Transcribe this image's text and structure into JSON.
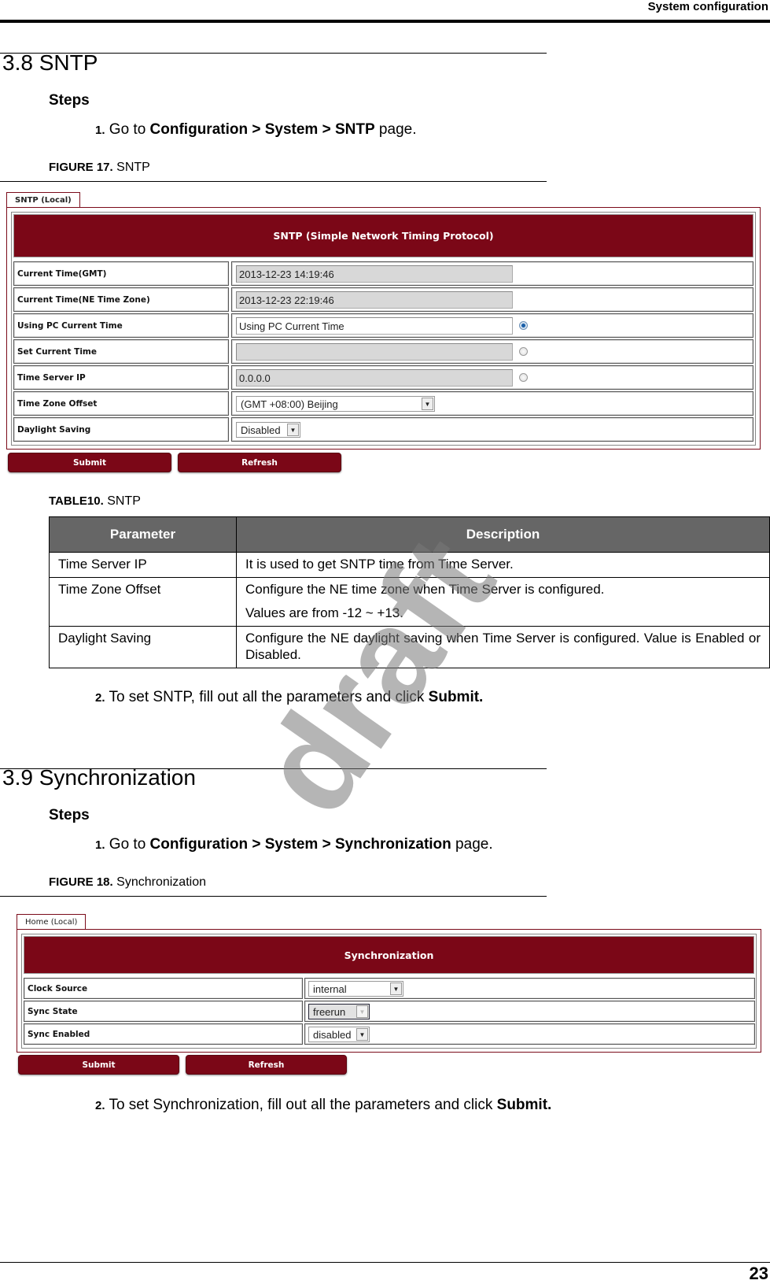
{
  "header": {
    "running_title": "System configuration"
  },
  "footer": {
    "page_number": "23"
  },
  "watermark": "draft",
  "sections": [
    {
      "title": "3.8 SNTP",
      "steps_label": "Steps",
      "step1": {
        "num": "1.",
        "prefix": "Go to ",
        "path": "Configuration > System > SNTP",
        "suffix": " page."
      },
      "figure": {
        "label": "FIGURE 17.",
        "title": "SNTP"
      },
      "step2": {
        "num": "2.",
        "prefix": "To set SNTP, fill out all the parameters and click ",
        "action": "Submit."
      }
    },
    {
      "title": "3.9 Synchronization",
      "steps_label": "Steps",
      "step1": {
        "num": "1.",
        "prefix": "Go to ",
        "path": "Configuration > System > Synchronization",
        "suffix": " page."
      },
      "figure": {
        "label": "FIGURE 18.",
        "title": "Synchronization"
      },
      "step2": {
        "num": "2.",
        "prefix": "To set Synchronization, fill out all the parameters and click ",
        "action": "Submit."
      }
    }
  ],
  "sntp_ui": {
    "tab": "SNTP (Local)",
    "banner": "SNTP (Simple Network Timing Protocol)",
    "rows": [
      {
        "label": "Current Time(GMT)",
        "value": "2013-12-23 14:19:46"
      },
      {
        "label": "Current Time(NE Time Zone)",
        "value": "2013-12-23 22:19:46"
      },
      {
        "label": "Using PC Current Time",
        "value": "Using PC Current Time",
        "radio": "selected"
      },
      {
        "label": "Set Current Time",
        "value": "",
        "radio": "unselected"
      },
      {
        "label": "Time Server IP",
        "value": "0.0.0.0",
        "radio": "unselected"
      },
      {
        "label": "Time Zone Offset",
        "value": "(GMT +08:00) Beijing"
      },
      {
        "label": "Daylight Saving",
        "value": "Disabled"
      }
    ],
    "buttons": {
      "submit": "Submit",
      "refresh": "Refresh"
    }
  },
  "table": {
    "label": "TABLE10.",
    "title": "SNTP",
    "headers": [
      "Parameter",
      "Description"
    ],
    "rows": [
      {
        "param": "Time Server IP",
        "desc": [
          "It is used to get SNTP time from Time Server."
        ]
      },
      {
        "param": "Time Zone Offset",
        "desc": [
          "Configure the NE time zone when Time Server is configured.",
          "Values are from -12 ~ +13."
        ]
      },
      {
        "param": "Daylight Saving",
        "desc": [
          "Configure the NE daylight saving when Time Server is configured. Value is Enabled or Disabled."
        ]
      }
    ]
  },
  "sync_ui": {
    "tab": "Home (Local)",
    "banner": "Synchronization",
    "rows": [
      {
        "label": "Clock Source",
        "value": "internal"
      },
      {
        "label": "Sync State",
        "value": "freerun"
      },
      {
        "label": "Sync Enabled",
        "value": "disabled"
      }
    ],
    "buttons": {
      "submit": "Submit",
      "refresh": "Refresh"
    }
  }
}
